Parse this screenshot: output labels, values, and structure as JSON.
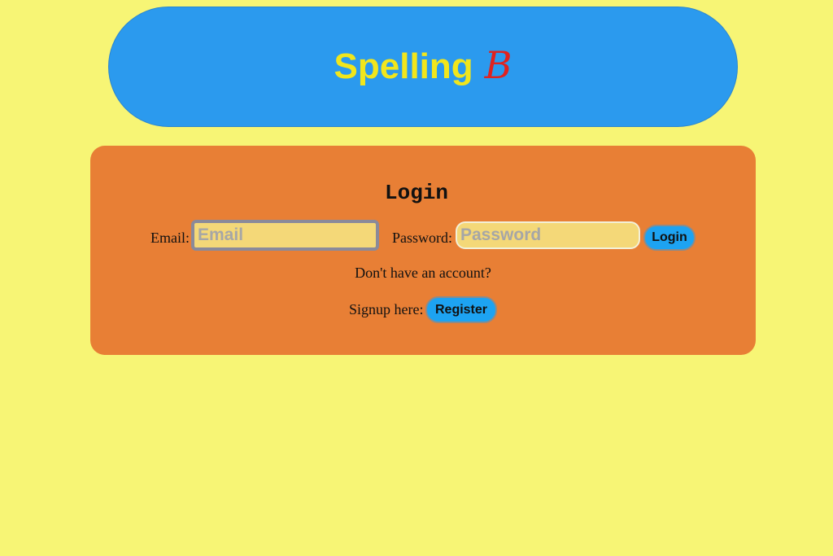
{
  "header": {
    "title_main": "Spelling",
    "title_logo": "B"
  },
  "login": {
    "heading": "Login",
    "email_label": "Email:",
    "email_placeholder": "Email",
    "password_label": "Password:",
    "password_placeholder": "Password",
    "login_button": "Login",
    "no_account_text": "Don't have an account?",
    "signup_label": "Signup here:",
    "register_button": "Register"
  },
  "colors": {
    "background": "#f7f575",
    "header_bg": "#2b9aee",
    "title_text": "#f1e61c",
    "logo_text": "#e0221f",
    "panel_bg": "#e87f35",
    "input_bg": "#f4d878",
    "button_bg": "#1da3f2"
  }
}
